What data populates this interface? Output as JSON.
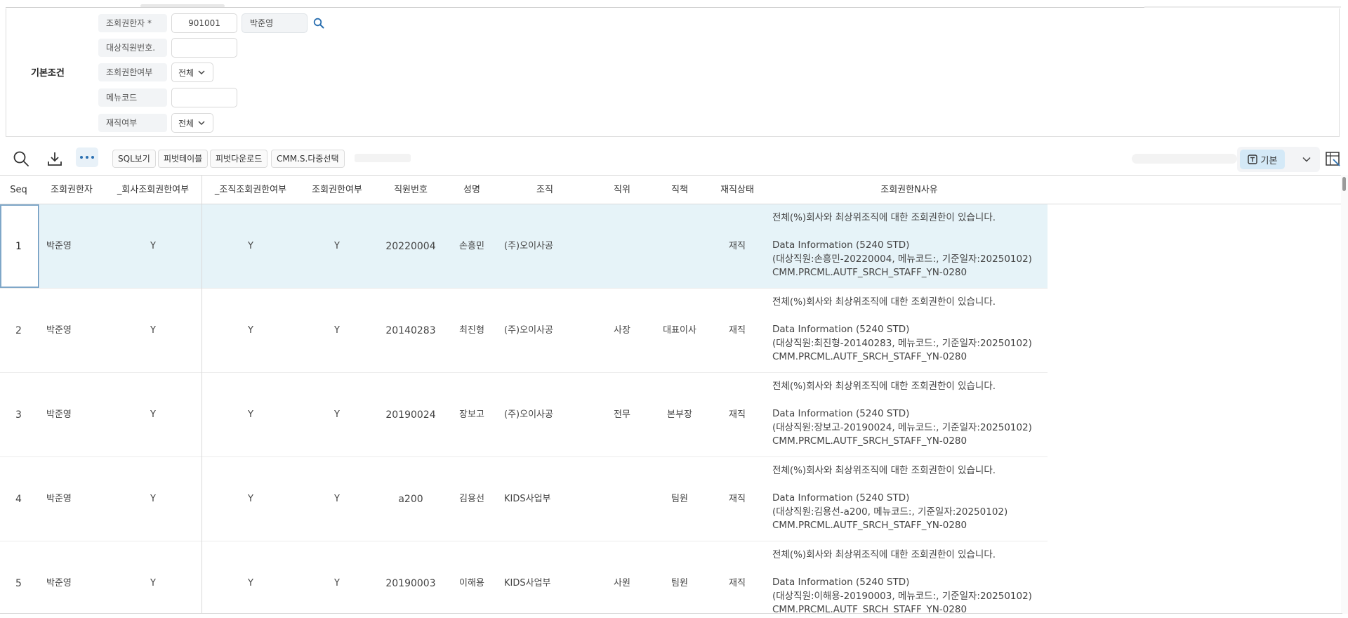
{
  "search": {
    "title": "기본조건",
    "fields": [
      {
        "label": "조회권한자 *",
        "value": "901001",
        "name_value": "박준영"
      },
      {
        "label": "대상직원번호.",
        "value": ""
      },
      {
        "label": "조회권한여부",
        "select": "전체"
      },
      {
        "label": "메뉴코드",
        "value": ""
      },
      {
        "label": "재직여부",
        "select": "전체"
      }
    ]
  },
  "toolbar": {
    "icons": [
      "search-icon",
      "download-icon",
      "more-icon"
    ],
    "buttons": [
      "SQL보기",
      "피벗테이블",
      "피벗다운로드",
      "CMM.S.다중선택"
    ],
    "view_label": "기본"
  },
  "table": {
    "columns": [
      "Seq",
      "조회권한자",
      "_회사조회권한여부",
      "_조직조회권한여부",
      "조회권한여부",
      "직원번호",
      "성명",
      "조직",
      "직위",
      "직책",
      "재직상태",
      "조회권한N사유"
    ],
    "rows": [
      {
        "seq": "1",
        "viewer": "박준영",
        "company_yn": "Y",
        "org_yn": "Y",
        "auth_yn": "Y",
        "emp_no": "20220004",
        "name": "손흥민",
        "org": "(주)오이사공",
        "position": "",
        "duty": "",
        "status": "재직",
        "reason": [
          "전체(%)회사와 최상위조직에 대한 조회권한이 있습니다.",
          "Data Information (5240 STD)",
          "(대상직원:손흥민-20220004, 메뉴코드:, 기준일자:20250102)",
          "CMM.PRCML.AUTF_SRCH_STAFF_YN-0280"
        ]
      },
      {
        "seq": "2",
        "viewer": "박준영",
        "company_yn": "Y",
        "org_yn": "Y",
        "auth_yn": "Y",
        "emp_no": "20140283",
        "name": "최진형",
        "org": "(주)오이사공",
        "position": "사장",
        "duty": "대표이사",
        "status": "재직",
        "reason": [
          "전체(%)회사와 최상위조직에 대한 조회권한이 있습니다.",
          "Data Information (5240 STD)",
          "(대상직원:최진형-20140283, 메뉴코드:, 기준일자:20250102)",
          "CMM.PRCML.AUTF_SRCH_STAFF_YN-0280"
        ]
      },
      {
        "seq": "3",
        "viewer": "박준영",
        "company_yn": "Y",
        "org_yn": "Y",
        "auth_yn": "Y",
        "emp_no": "20190024",
        "name": "장보고",
        "org": "(주)오이사공",
        "position": "전무",
        "duty": "본부장",
        "status": "재직",
        "reason": [
          "전체(%)회사와 최상위조직에 대한 조회권한이 있습니다.",
          "Data Information (5240 STD)",
          "(대상직원:장보고-20190024, 메뉴코드:, 기준일자:20250102)",
          "CMM.PRCML.AUTF_SRCH_STAFF_YN-0280"
        ]
      },
      {
        "seq": "4",
        "viewer": "박준영",
        "company_yn": "Y",
        "org_yn": "Y",
        "auth_yn": "Y",
        "emp_no": "a200",
        "name": "김용선",
        "org": "KIDS사업부",
        "position": "",
        "duty": "팀원",
        "status": "재직",
        "reason": [
          "전체(%)회사와 최상위조직에 대한 조회권한이 있습니다.",
          "Data Information (5240 STD)",
          "(대상직원:김용선-a200, 메뉴코드:, 기준일자:20250102)",
          "CMM.PRCML.AUTF_SRCH_STAFF_YN-0280"
        ]
      },
      {
        "seq": "5",
        "viewer": "박준영",
        "company_yn": "Y",
        "org_yn": "Y",
        "auth_yn": "Y",
        "emp_no": "20190003",
        "name": "이해용",
        "org": "KIDS사업부",
        "position": "사원",
        "duty": "팀원",
        "status": "재직",
        "reason": [
          "전체(%)회사와 최상위조직에 대한 조회권한이 있습니다.",
          "Data Information (5240 STD)",
          "(대상직원:이해용-20190003, 메뉴코드:, 기준일자:20250102)",
          "CMM.PRCML.AUTF_SRCH_STAFF_YN-0280"
        ]
      }
    ]
  },
  "colors": {
    "selected_row": "#e6f3f8",
    "accent": "#2a6fb0",
    "view_button": "#d4e9f7"
  }
}
